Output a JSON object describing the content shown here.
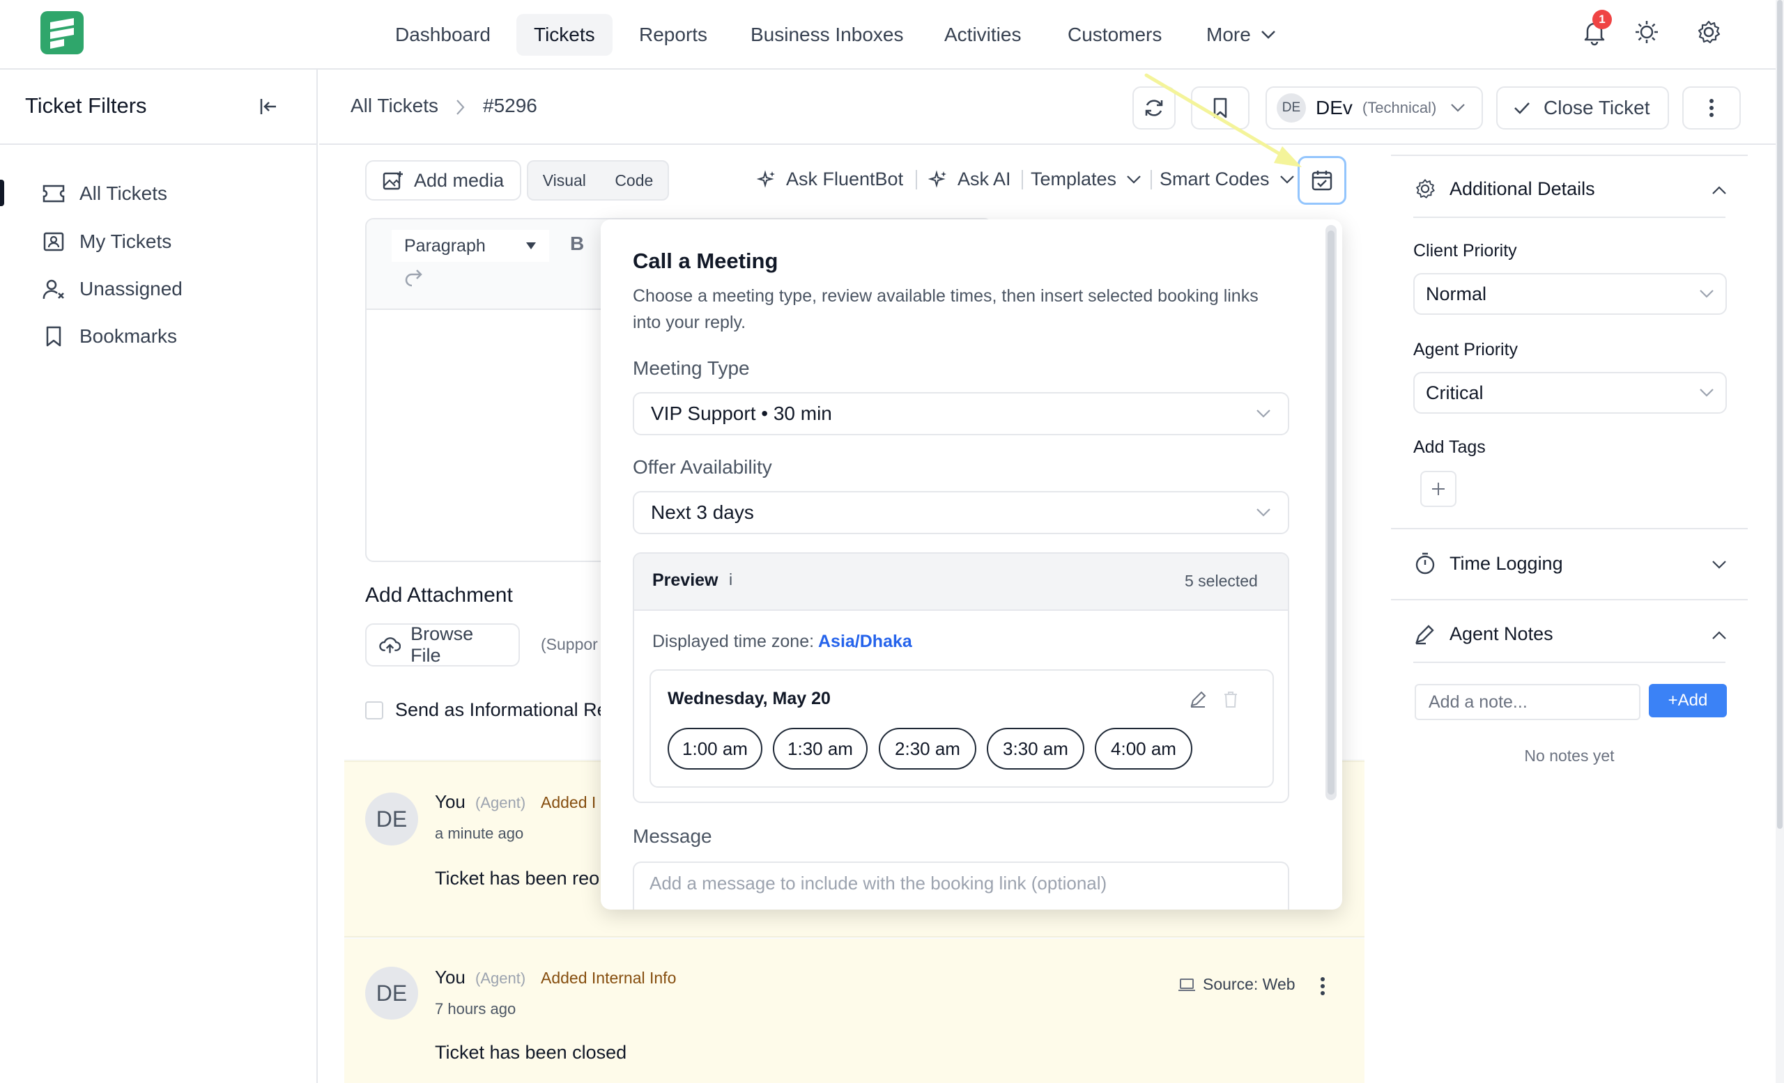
{
  "nav": {
    "items": [
      "Dashboard",
      "Tickets",
      "Reports",
      "Business Inboxes",
      "Activities",
      "Customers"
    ],
    "more": "More",
    "notif_count": "1"
  },
  "sidebar": {
    "title": "Ticket Filters",
    "items": [
      "All Tickets",
      "My Tickets",
      "Unassigned",
      "Bookmarks"
    ]
  },
  "header": {
    "breadcrumb_root": "All Tickets",
    "ticket_id": "#5296",
    "agent_initials": "DE",
    "agent_name": "DEv",
    "agent_role": "(Technical)",
    "close_label": "Close Ticket"
  },
  "editor": {
    "add_media": "Add media",
    "tab_visual": "Visual",
    "tab_code": "Code",
    "ask_fluentbot": "Ask FluentBot",
    "ask_ai": "Ask AI",
    "templates": "Templates",
    "smart_codes": "Smart Codes",
    "paragraph": "Paragraph",
    "bold": "B"
  },
  "attachment": {
    "title": "Add Attachment",
    "browse": "Browse File",
    "supported": "(Suppor",
    "send_info": "Send as Informational Re"
  },
  "meeting": {
    "title": "Call a Meeting",
    "desc_line1": "Choose a meeting type, review available times, then insert selected booking links",
    "desc_line2": "into your reply.",
    "type_label": "Meeting Type",
    "type_value": "VIP Support • 30 min",
    "avail_label": "Offer Availability",
    "avail_value": "Next 3 days",
    "preview_label": "Preview",
    "preview_info": "i",
    "selected": "5 selected",
    "tz_label": "Displayed time zone:",
    "tz_value": "Asia/Dhaka",
    "day": "Wednesday, May 20",
    "slots": [
      "1:00 am",
      "1:30 am",
      "2:30 am",
      "3:30 am",
      "4:00 am"
    ],
    "message_label": "Message",
    "message_placeholder": "Add a message to include with the booking link (optional)"
  },
  "activity": [
    {
      "initials": "DE",
      "who": "You",
      "role": "(Agent)",
      "action": "Added I",
      "time": "a minute ago",
      "body": "Ticket has been reo"
    },
    {
      "initials": "DE",
      "who": "You",
      "role": "(Agent)",
      "action": "Added Internal Info",
      "time": "7 hours ago",
      "body": "Ticket has been closed",
      "source": "Source: Web"
    }
  ],
  "details": {
    "title": "Additional Details",
    "client_priority_label": "Client Priority",
    "client_priority": "Normal",
    "agent_priority_label": "Agent Priority",
    "agent_priority": "Critical",
    "tags_label": "Add Tags",
    "time_logging": "Time Logging",
    "agent_notes": "Agent Notes",
    "note_placeholder": "Add a note...",
    "add_btn": "+Add",
    "no_notes": "No notes yet"
  },
  "colors": {
    "accent": "#3b82f6",
    "brand": "#2fa66b",
    "highlight_arrow": "#f4f49a",
    "activity_bg": "#fefbea"
  }
}
